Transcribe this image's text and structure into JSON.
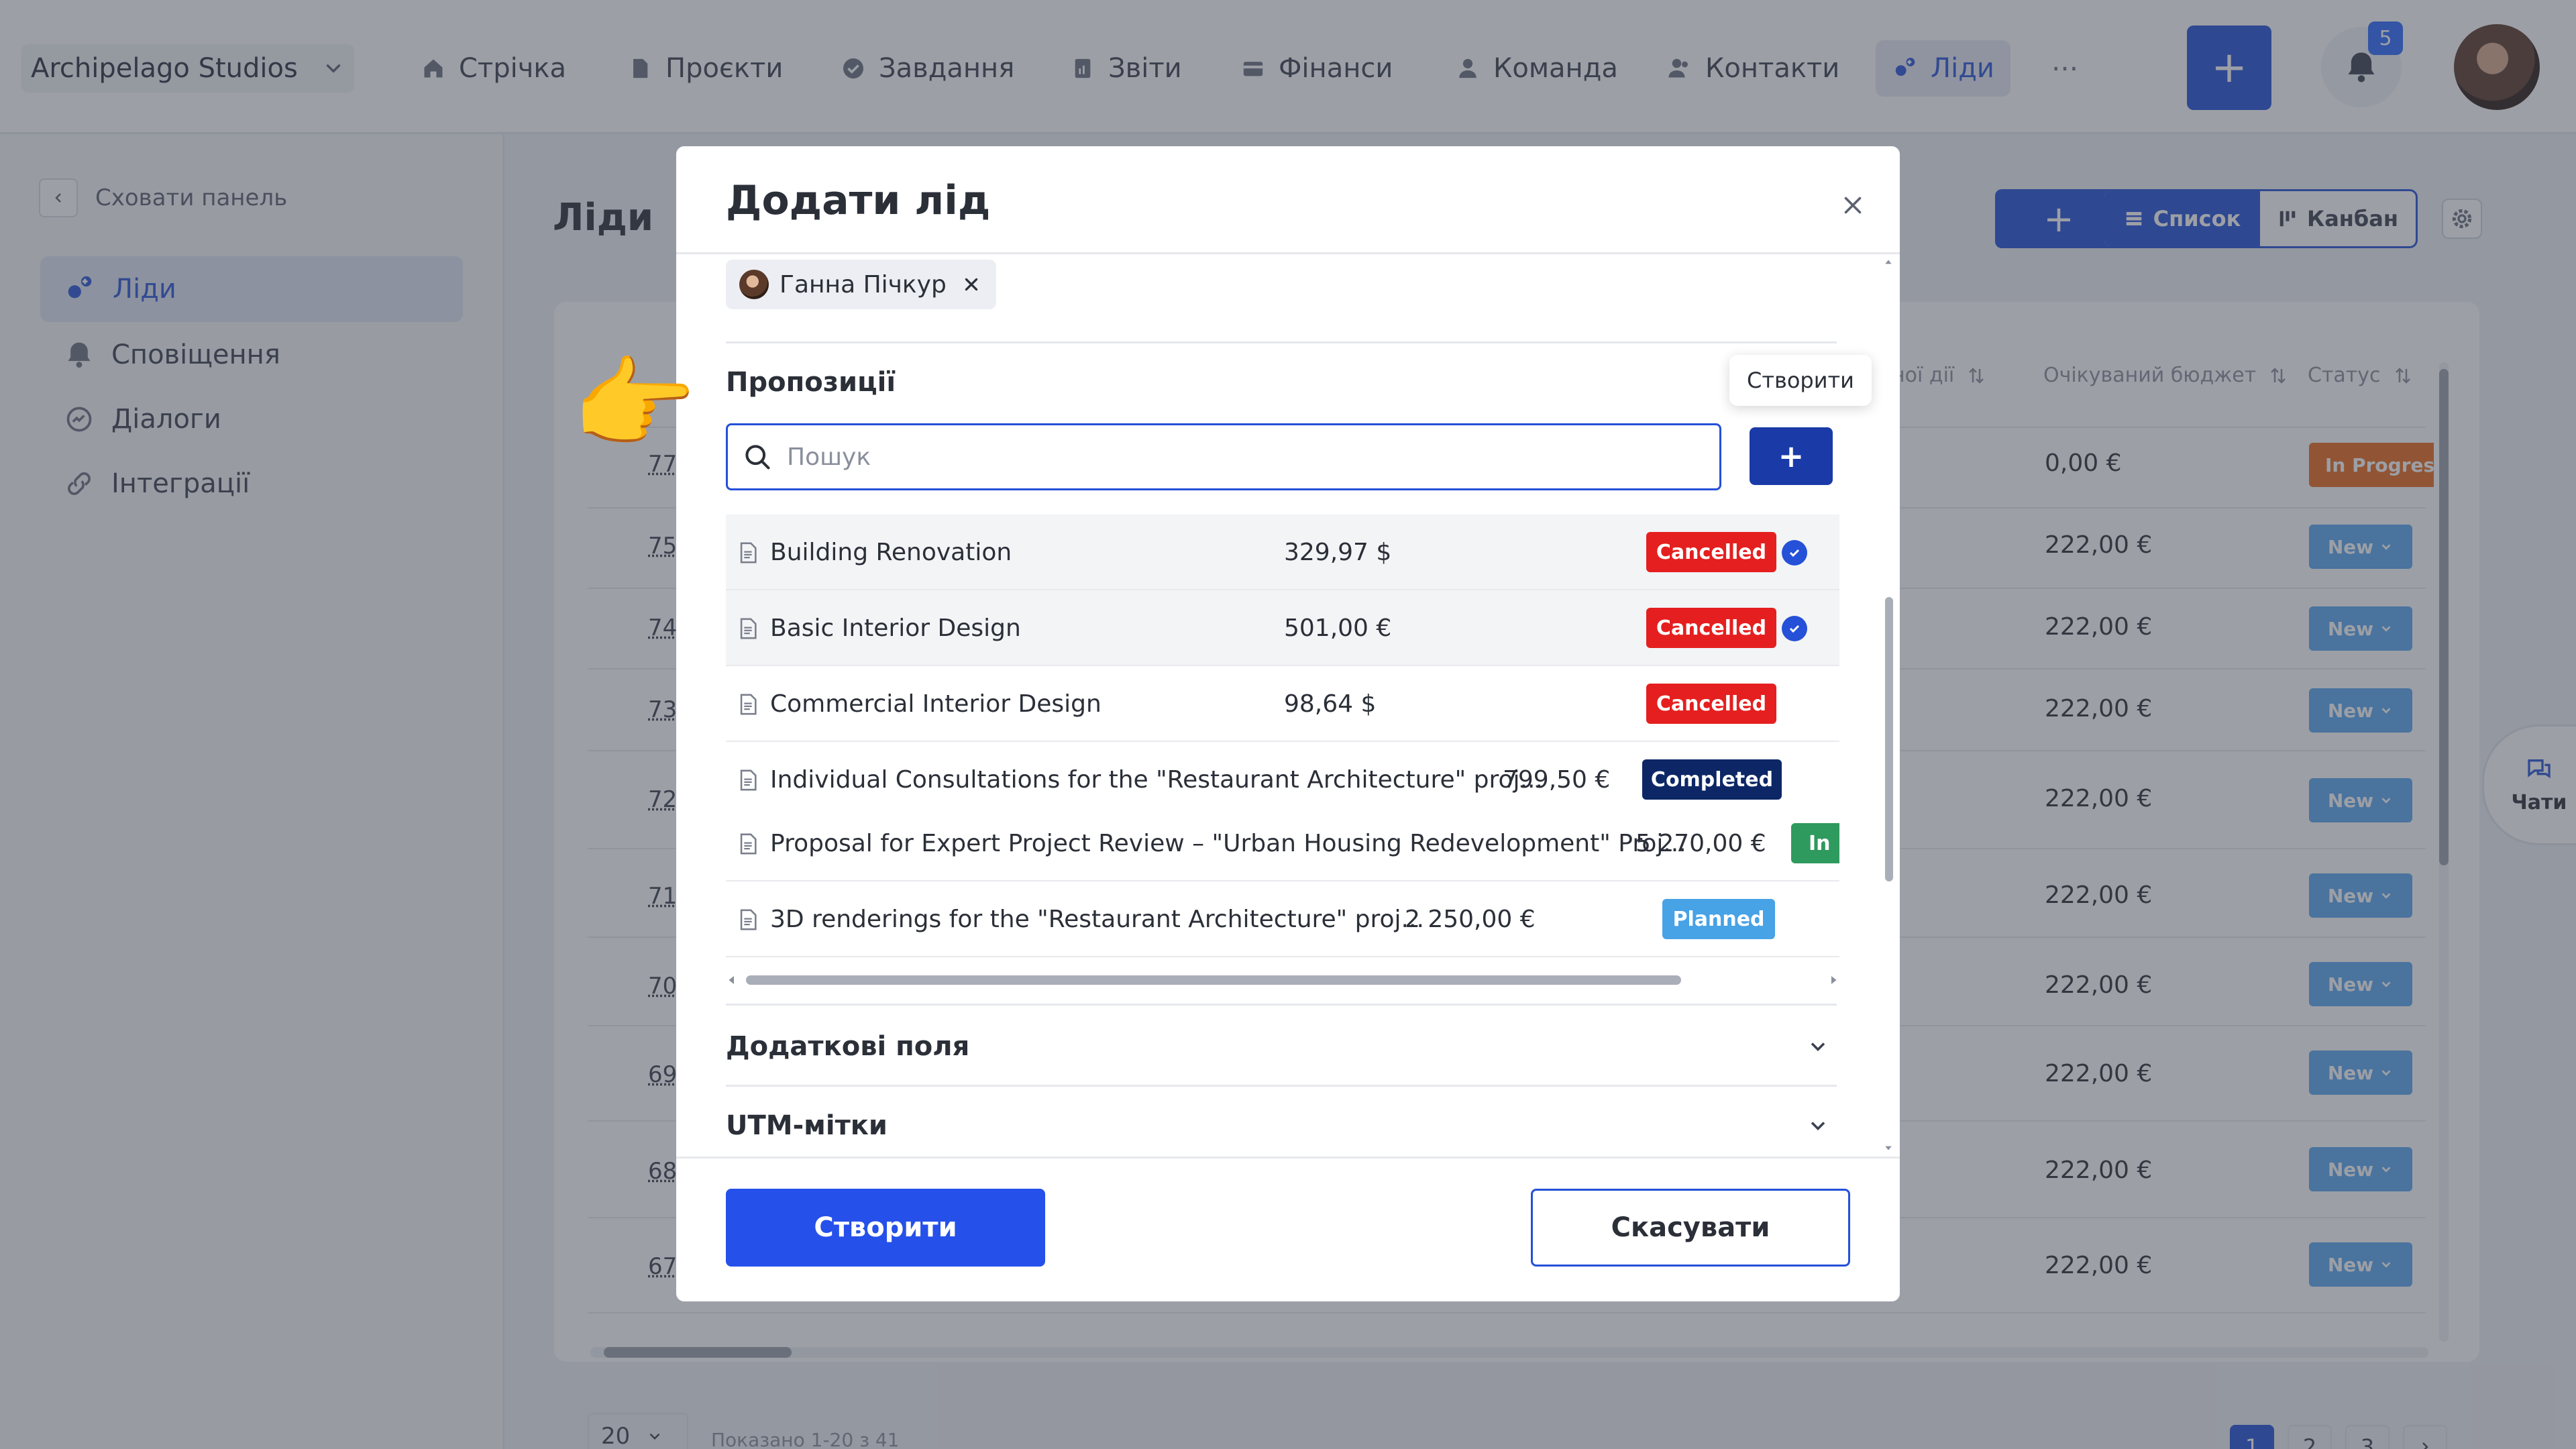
{
  "topbar": {
    "company": "Archipelago Studios",
    "nav": [
      {
        "label": "Стрічка",
        "icon": "home-icon"
      },
      {
        "label": "Проєкти",
        "icon": "document-icon"
      },
      {
        "label": "Завдання",
        "icon": "check-circle-icon"
      },
      {
        "label": "Звіти",
        "icon": "report-icon"
      },
      {
        "label": "Фінанси",
        "icon": "wallet-icon"
      },
      {
        "label": "Команда",
        "icon": "user-icon"
      },
      {
        "label": "Контакти",
        "icon": "contacts-icon"
      },
      {
        "label": "Ліди",
        "icon": "leads-icon",
        "active": true
      }
    ],
    "more": "···",
    "add_label": "+",
    "notifications_count": "5"
  },
  "sidebar": {
    "hide_label": "Сховати панель",
    "items": [
      {
        "label": "Ліди",
        "icon": "leads-icon",
        "active": true
      },
      {
        "label": "Сповіщення",
        "icon": "bell-icon"
      },
      {
        "label": "Діалоги",
        "icon": "chat-icon"
      },
      {
        "label": "Інтеграції",
        "icon": "link-icon"
      }
    ]
  },
  "main": {
    "title": "Ліди",
    "add_label": "+",
    "view_list": "Список",
    "view_kanban": "Канбан",
    "columns": {
      "last_action": "ної дії",
      "budget": "Очікуваний бюджет",
      "status": "Статус"
    },
    "rows": [
      {
        "id": "77",
        "budget": "0,00 €",
        "status": "In Progress"
      },
      {
        "id": "75",
        "budget": "222,00 €",
        "status": "New"
      },
      {
        "id": "74",
        "budget": "222,00 €",
        "status": "New"
      },
      {
        "id": "73",
        "budget": "222,00 €",
        "status": "New"
      },
      {
        "id": "72",
        "budget": "222,00 €",
        "status": "New"
      },
      {
        "id": "71",
        "budget": "222,00 €",
        "status": "New"
      },
      {
        "id": "70",
        "budget": "222,00 €",
        "status": "New"
      },
      {
        "id": "69",
        "budget": "222,00 €",
        "status": "New"
      },
      {
        "id": "68",
        "budget": "222,00 €",
        "status": "New"
      },
      {
        "id": "67",
        "budget": "222,00 €",
        "status": "New"
      }
    ],
    "page_size": "20",
    "shown_info": "Показано 1-20 з 41",
    "pages": [
      "1",
      "2",
      "3"
    ],
    "chats_label": "Чати"
  },
  "modal": {
    "title": "Додати лід",
    "assignee": "Ганна Пічкур",
    "section_title": "Пропозиції",
    "tooltip": "Створити",
    "search_placeholder": "Пошук",
    "add_label": "+",
    "proposals": [
      {
        "name": "Building Renovation",
        "price": "329,97 $",
        "status": "Cancelled",
        "status_color": "#e51f1f",
        "checked": true
      },
      {
        "name": "Basic Interior Design",
        "price": "501,00 €",
        "status": "Cancelled",
        "status_color": "#e51f1f",
        "checked": true
      },
      {
        "name": "Commercial Interior Design",
        "price": "98,64 $",
        "status": "Cancelled",
        "status_color": "#e51f1f",
        "checked": false
      },
      {
        "name": "Individual Consultations for the \"Restaurant Architecture\" proj...",
        "price": "799,50 €",
        "status": "Completed",
        "status_color": "#0d2766",
        "checked": false
      },
      {
        "name": "Proposal for Expert Project Review – \"Urban Housing Redevelopment\" Proj...",
        "price": "5 270,00 €",
        "status": "In",
        "status_color": "#2f9a5e",
        "checked": false
      },
      {
        "name": "3D renderings for the \"Restaurant Architecture\" proj...",
        "price": "2 250,00 €",
        "status": "Planned",
        "status_color": "#47a2e6",
        "checked": false
      }
    ],
    "extra_fields": "Додаткові поля",
    "utm": "UTM-мітки",
    "create_label": "Створити",
    "cancel_label": "Скасувати"
  }
}
